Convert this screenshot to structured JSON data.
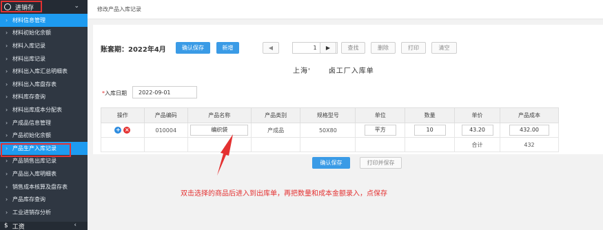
{
  "sidebar": {
    "header": "进销存",
    "items": [
      "材料信息管理",
      "材料初始化余额",
      "材料入库记录",
      "材料出库记录",
      "材料出入库汇总明细表",
      "材料出入库盘存表",
      "材料库存查询",
      "材料出库成本分配表",
      "产成品信息管理",
      "产品初始化余额",
      "产品生产入库记录",
      "产品销售出库记录",
      "产品出入库明细表",
      "销售成本核算及盘存表",
      "产品库存查询",
      "工业进销存分析"
    ],
    "footer": "工资"
  },
  "breadcrumb": "修改产品入库记录",
  "toolbar": {
    "period": "账套期：2022年4月",
    "confirm_save": "确认保存",
    "add_new": "新增",
    "prev": "◀",
    "page": "1",
    "next": "▶",
    "find": "查找",
    "delete": "删除",
    "print": "打印",
    "clear": "清空"
  },
  "bill": {
    "left": "上海'",
    "right": "卤工厂入库单"
  },
  "date": {
    "label": "入库日期",
    "value": "2022-09-01"
  },
  "table": {
    "headers": [
      "操作",
      "产品编码",
      "产品名称",
      "产品类别",
      "规格型号",
      "单位",
      "数量",
      "单价",
      "产品成本"
    ],
    "row": {
      "code": "010004",
      "name": "编织袋",
      "category": "产成品",
      "spec": "50X80",
      "unit": "平方",
      "qty": "10",
      "price": "43.20",
      "cost": "432.00"
    },
    "total_label": "合计",
    "total_value": "432"
  },
  "bottom": {
    "confirm_save": "确认保存",
    "print_save": "打印并保存"
  },
  "annotation": "双击选择的商品后进入到出库单，再把数量和成本金额录入，点保存",
  "colors": {
    "sidebar_bg": "#2f3742",
    "active": "#1e9bf0",
    "accent": "#3a9be6",
    "annot": "#e43131"
  }
}
